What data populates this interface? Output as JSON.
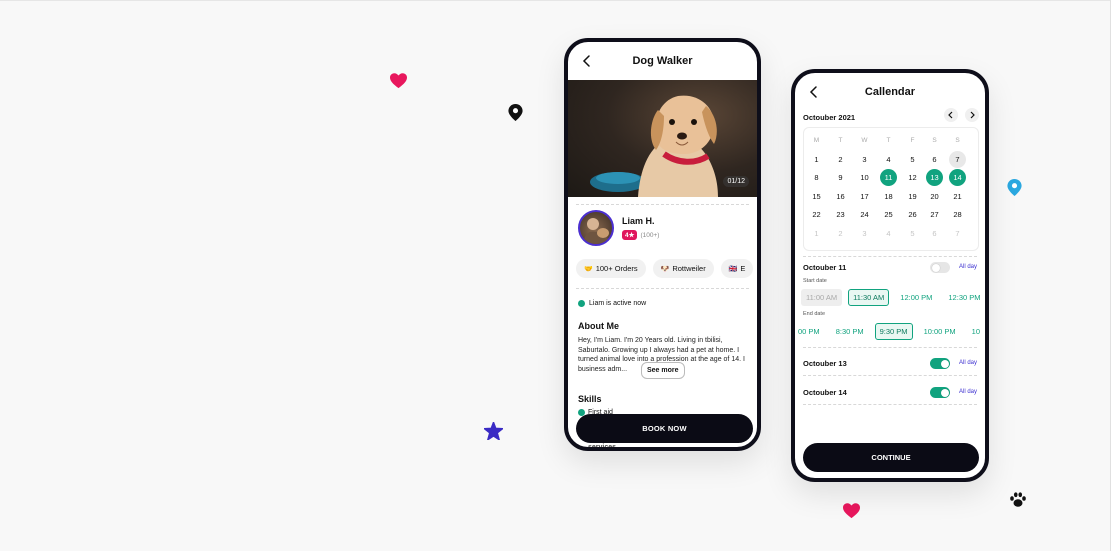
{
  "colors": {
    "accent": "#11a37f",
    "pink": "#e0165d",
    "purple": "#3b2fd0",
    "dark": "#0b0b15"
  },
  "decorations": {
    "heart_icons": [
      "heart-icon",
      "heart-icon"
    ],
    "pin_icons": [
      "map-pin-icon",
      "map-pin-icon"
    ],
    "star_icon": "star-icon",
    "paw_icon": "paw-icon"
  },
  "dog_walker": {
    "title": "Dog Walker",
    "photo_counter": "01/12",
    "user_name": "Liam H.",
    "rating": "4★",
    "rating_count": "(100+)",
    "tags": [
      {
        "icon": "handshake-icon",
        "label": "100+ Orders"
      },
      {
        "icon": "dog-icon",
        "label": "Rottweiler"
      },
      {
        "icon": "flag-icon",
        "label": "E"
      }
    ],
    "status": "Liam is active now",
    "about_heading": "About Me",
    "about_text": "Hey, I'm Liam. I'm 20 Years old. Living in tbilisi, Saburtalo. Growing up I always had a pet at home. I turned animal love into a profession at the age of 14. I      business adm...",
    "see_more": "See more",
    "skills_heading": "Skills",
    "skills": [
      "First aid"
    ],
    "cut_text": "services",
    "book_button": "BOOK NOW"
  },
  "calendar": {
    "title": "Callendar",
    "month": "Octouber 2021",
    "weekdays": [
      "M",
      "T",
      "W",
      "T",
      "F",
      "S",
      "S"
    ],
    "days": [
      [
        "1",
        "2",
        "3",
        "4",
        "5",
        "6",
        "7"
      ],
      [
        "8",
        "9",
        "10",
        "11",
        "12",
        "13",
        "14"
      ],
      [
        "15",
        "16",
        "17",
        "18",
        "19",
        "20",
        "21"
      ],
      [
        "22",
        "23",
        "24",
        "25",
        "26",
        "27",
        "28"
      ],
      [
        "1",
        "2",
        "3",
        "4",
        "5",
        "6",
        "7"
      ]
    ],
    "selected_days": [
      "11",
      "13",
      "14"
    ],
    "today": "7",
    "sections": [
      {
        "label": "Octouber 11",
        "all_day": "All day",
        "toggle_on": false
      },
      {
        "label": "Octouber 13",
        "all_day": "All day",
        "toggle_on": true
      },
      {
        "label": "Octouber 14",
        "all_day": "All day",
        "toggle_on": true
      }
    ],
    "start_label": "Start date",
    "start_times": [
      "11:00 AM",
      "11:30 AM",
      "12:00 PM",
      "12:30 PM"
    ],
    "start_selected": "11:30 AM",
    "start_disabled": "11:00 AM",
    "end_label": "End date",
    "end_times": [
      "00 PM",
      "8:30 PM",
      "9:30 PM",
      "10:00 PM",
      "10"
    ],
    "end_selected": "9:30 PM",
    "continue_button": "CONTINUE"
  }
}
